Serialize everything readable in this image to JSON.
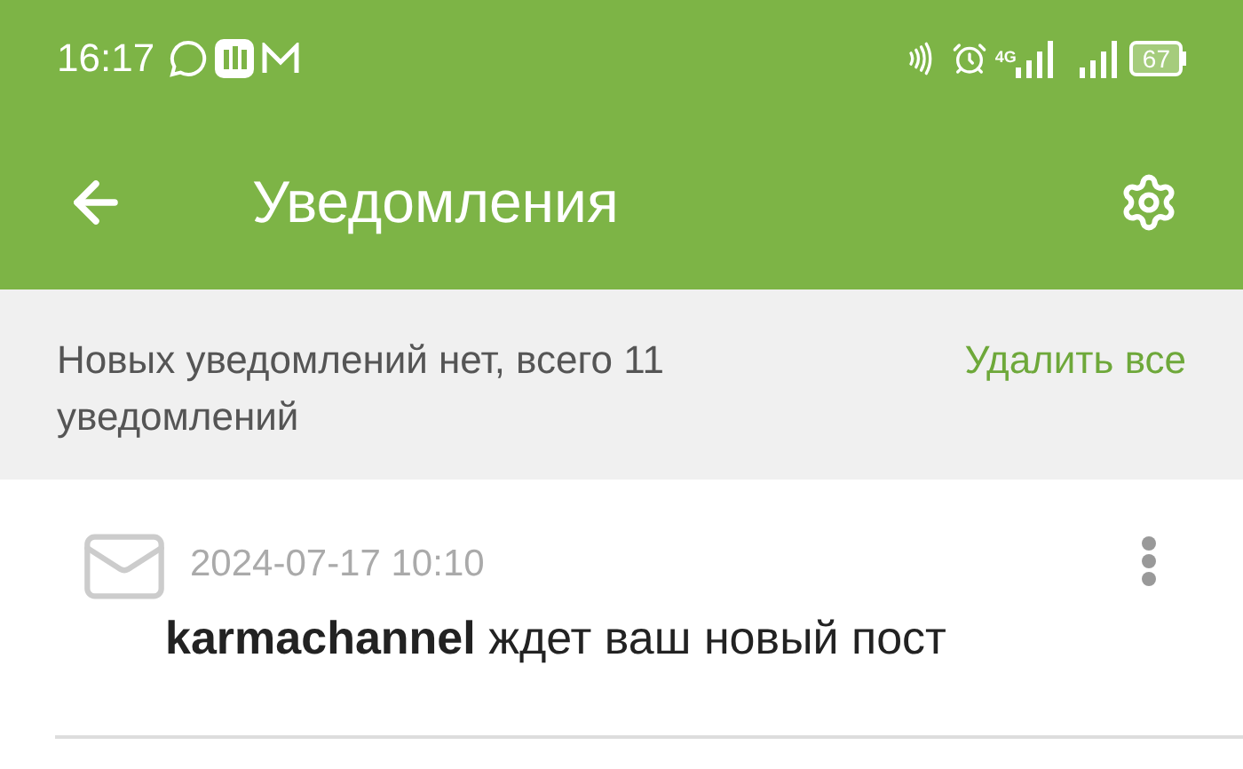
{
  "status_bar": {
    "time": "16:17",
    "network": "4G",
    "battery": "67"
  },
  "app_bar": {
    "title": "Уведомления"
  },
  "banner": {
    "text": "Новых уведомлений нет, всего 11 уведомлений",
    "action": "Удалить все"
  },
  "notifications": [
    {
      "date": "2024-07-17 10:10",
      "message": "**karmachannel** ждет ваш новый пост"
    }
  ]
}
